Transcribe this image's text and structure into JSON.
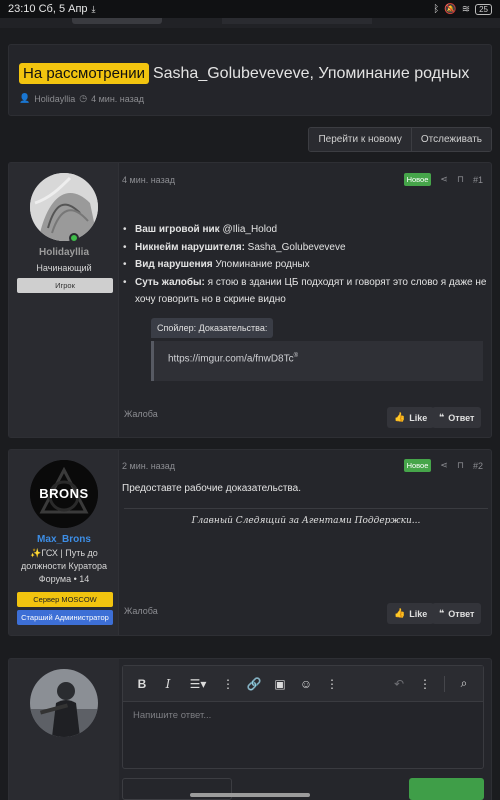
{
  "status_bar": {
    "time_date": "23:10 Сб, 5 Апр",
    "battery": "25"
  },
  "thread": {
    "status_label": "На рассмотрении",
    "title": "Sasha_Golubeveveve, Упоминание родных",
    "author": "Holidayllia",
    "time": "4 мин. назад"
  },
  "actions": {
    "go_new": "Перейти к новому",
    "watch": "Отслеживать"
  },
  "posts": [
    {
      "username": "Holidayllia",
      "user_title": "Начинающий",
      "badge": "Игрок",
      "time": "4 мин. назад",
      "new_label": "Новое",
      "number": "#1",
      "fields": [
        {
          "label": "Ваш игровой ник",
          "value": " @Ilia_Holod"
        },
        {
          "label": "Никнейм нарушителя:",
          "value": " Sasha_Golubeveveve"
        },
        {
          "label": "Вид нарушения",
          "value": " Упоминание родных"
        },
        {
          "label": "Суть жалобы:",
          "value": " я стою в здании ЦБ подходят и говорят это слово я даже не хочу говорить но в скрине видно"
        }
      ],
      "spoiler_label": "Спойлер: Доказательства:",
      "spoiler_link": "https://imgur.com/a/fnwD8Tc",
      "complaint": "Жалоба",
      "like": "Like",
      "reply": "Ответ"
    },
    {
      "username": "Max_Brons",
      "avatar_text": "BRONS",
      "user_title": "✨ГСХ | Путь до должности Куратора Форума • 14",
      "badge_server": "Сервер MOSCOW",
      "badge_role": "Старший Администратор",
      "time": "2 мин. назад",
      "new_label": "Новое",
      "number": "#2",
      "text": "Предоставте рабочие доказательства.",
      "signature": "Главный Следящий за Агентами Поддержки...",
      "complaint": "Жалоба",
      "like": "Like",
      "reply": "Ответ"
    }
  ],
  "editor": {
    "placeholder": "Напишите ответ..."
  },
  "colors": {
    "review_badge": "#f2c40f",
    "new_badge": "#46a54a",
    "online": "#3fbd4a",
    "server_badge": "#f2c40f",
    "role_badge": "#3d6fd6",
    "staff_name": "#3d8ee6"
  }
}
